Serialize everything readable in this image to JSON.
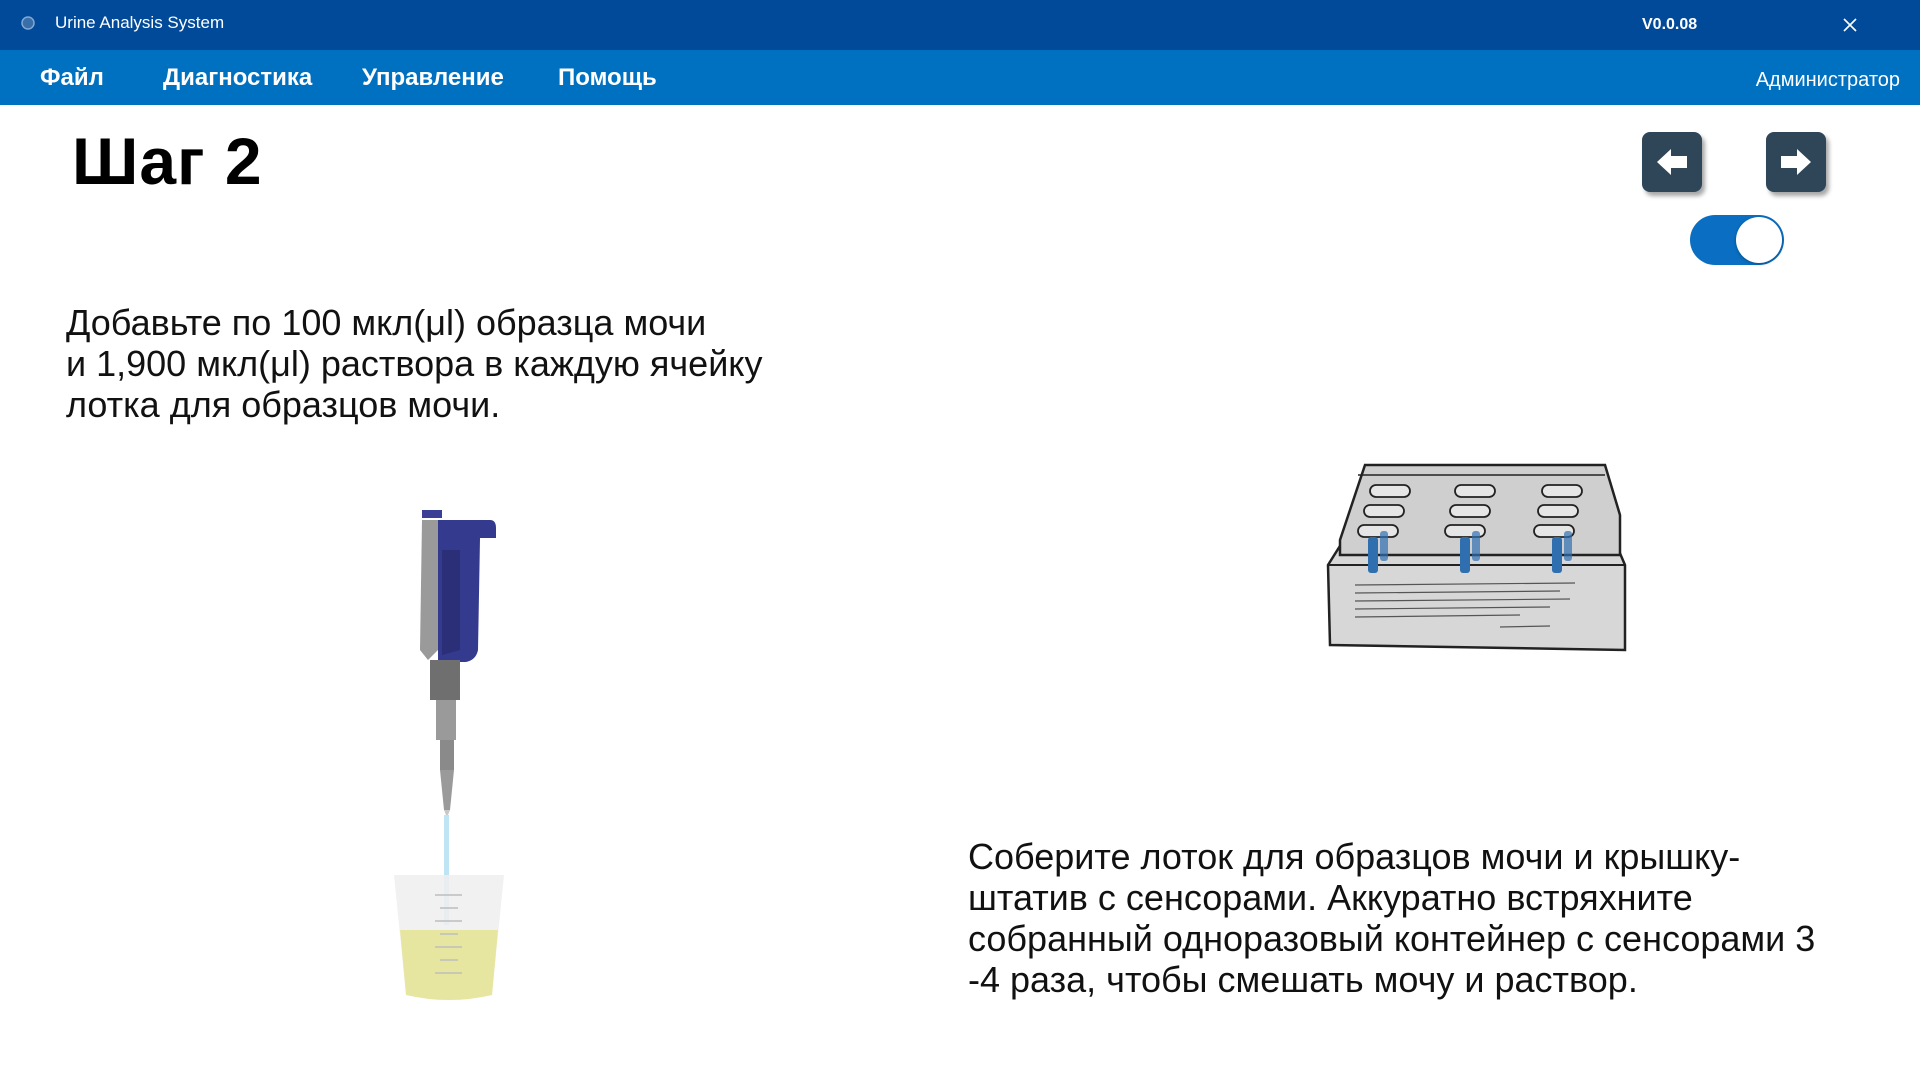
{
  "window": {
    "title": "Urine Analysis System",
    "version": "V0.0.08",
    "close_icon": "close-icon"
  },
  "menu": {
    "items": [
      "Файл",
      "Диагностика",
      "Управление",
      "Помощь"
    ],
    "user": "Администратор"
  },
  "step": {
    "title": "Шаг 2",
    "left_text": [
      "Добавьте по 100 мкл(μl) образца мочи",
      "и 1,900 мкл(μl) раствора в каждую ячейку",
      "лотка для образцов мочи."
    ],
    "right_text": [
      "Соберите лоток для образцов мочи и крышку-",
      "штатив с сенсорами. Аккуратно встряхните",
      "собранный одноразовый контейнер с сенсорами 3",
      "-4 раза, чтобы смешать мочу и раствор."
    ]
  },
  "nav": {
    "prev_icon": "arrow-left-icon",
    "next_icon": "arrow-right-icon",
    "toggle_on": true
  },
  "colors": {
    "titlebar": "#004a99",
    "menubar": "#0070c0",
    "nav_button": "#2f4558",
    "toggle": "#0a6fc2"
  }
}
